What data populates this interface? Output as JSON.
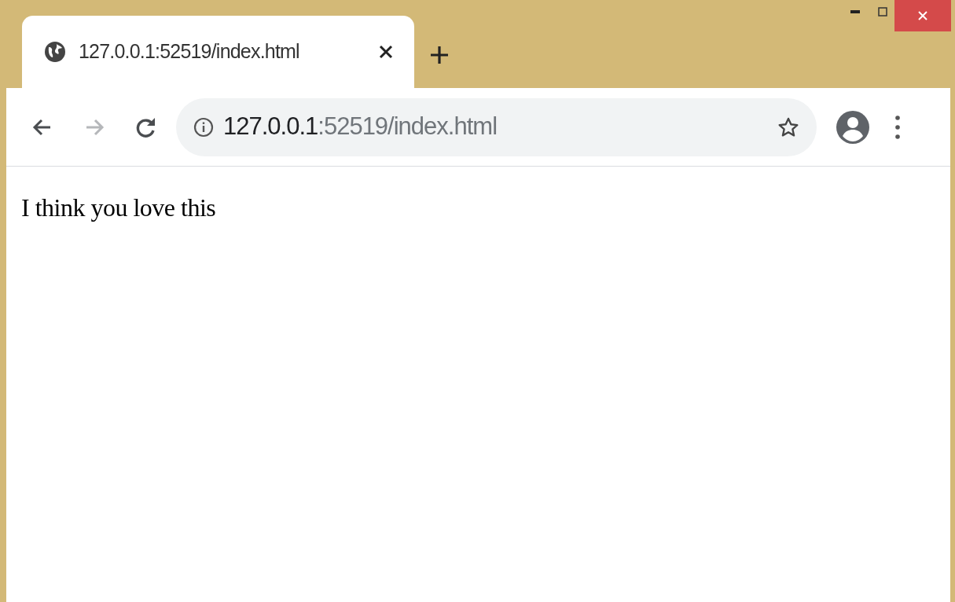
{
  "tabs": [
    {
      "title": "127.0.0.1:52519/index.html",
      "selected": true
    }
  ],
  "nav_buttons": [
    {
      "kind": "back",
      "disabled": false
    },
    {
      "kind": "forward",
      "disabled": true
    },
    {
      "kind": "reload",
      "disabled": false
    }
  ],
  "address": {
    "host": "127.0.0.1",
    "rest": ":52519/index.html"
  },
  "page": {
    "text": "I think you love this"
  }
}
